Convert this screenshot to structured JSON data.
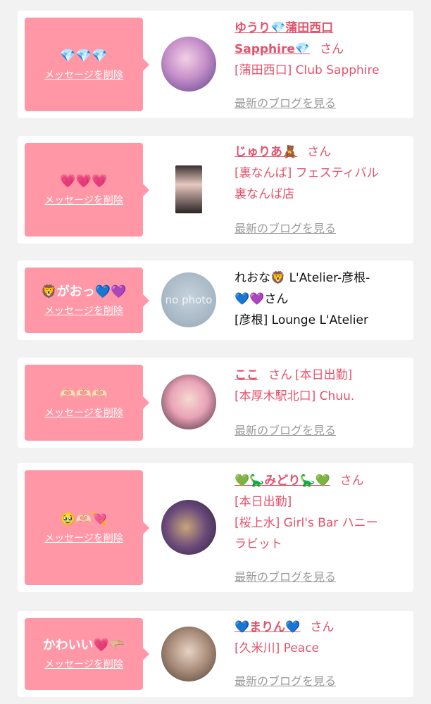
{
  "colors": {
    "accent": "#ff97a6",
    "name_pink": "#e5526b",
    "link_gray": "#9a9a9a"
  },
  "icons": {
    "nophoto": "no-photo-placeholder"
  },
  "cards": [
    {
      "message": "💎💎💎",
      "delete_label": "メッセージを削除",
      "name_line1": "ゆうり💎蒲田西口",
      "name_line2": "Sapphire💎",
      "san": "さん",
      "shop": "[蒲田西口] Club Sapphire",
      "blog": "最新のブログを見る"
    },
    {
      "message": "💗💗💗",
      "delete_label": "メッセージを削除",
      "name": "じゅりあ🧸",
      "san": "さん",
      "shop_line1": "[裏なんば] フェスティバル",
      "shop_line2": "裏なんば店",
      "blog": "最新のブログを見る"
    },
    {
      "message": "🦁がおっ💙💜",
      "delete_label": "メッセージを削除",
      "avatar_text": "no photo",
      "name_line1": "れおな🦁 L'Atelier-彦根-",
      "name_line2": "💙💜さん",
      "shop": "[彦根] Lounge L'Atelier"
    },
    {
      "message": "🫶🏻🫶🏻🫶🏻",
      "delete_label": "メッセージを削除",
      "name": "ここ",
      "san": "さん",
      "status": "[本日出勤]",
      "shop": "[本厚木駅北口] Chuu.",
      "blog": "最新のブログを見る"
    },
    {
      "message": "🥹🫶🏻💘",
      "delete_label": "メッセージを削除",
      "name": "💚🦕みどり🦕💚",
      "san": "さん",
      "status": "[本日出勤]",
      "shop_line1": "[桜上水] Girl's Bar ハニー",
      "shop_line2": "ラビット",
      "blog": "最新のブログを見る"
    },
    {
      "message": "かわいい💗🫳🏼",
      "delete_label": "メッセージを削除",
      "name": "💙まりん💙",
      "san": "さん",
      "shop": "[久米川] Peace",
      "blog": "最新のブログを見る"
    }
  ]
}
